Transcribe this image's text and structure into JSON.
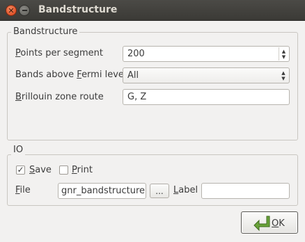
{
  "window": {
    "title": "Bandstructure"
  },
  "bandstructure_group": {
    "title": "Bandstructure",
    "points_per_segment": {
      "label_prefix": "",
      "label_mnemonic": "P",
      "label_rest": "oints per segment",
      "value": "200"
    },
    "bands_above_fermi": {
      "label_prefix": "Bands above ",
      "label_mnemonic": "F",
      "label_rest": "ermi level",
      "value": "All"
    },
    "brillouin_route": {
      "label_prefix": "",
      "label_mnemonic": "B",
      "label_rest": "rillouin zone route",
      "value": "G, Z"
    }
  },
  "io_group": {
    "title": "IO",
    "save": {
      "mnemonic": "S",
      "rest": "ave",
      "checked": true,
      "mark": "✓"
    },
    "print": {
      "mnemonic": "P",
      "rest": "rint",
      "checked": false
    },
    "file": {
      "mnemonic": "F",
      "rest": "ile",
      "value": "gnr_bandstructure.n",
      "browse_label": "..."
    },
    "label": {
      "mnemonic": "L",
      "rest": "abel",
      "value": ""
    }
  },
  "ok_button": {
    "mnemonic": "O",
    "rest": "K",
    "icon": "back-arrow-icon",
    "icon_color": "#6aa33a"
  }
}
